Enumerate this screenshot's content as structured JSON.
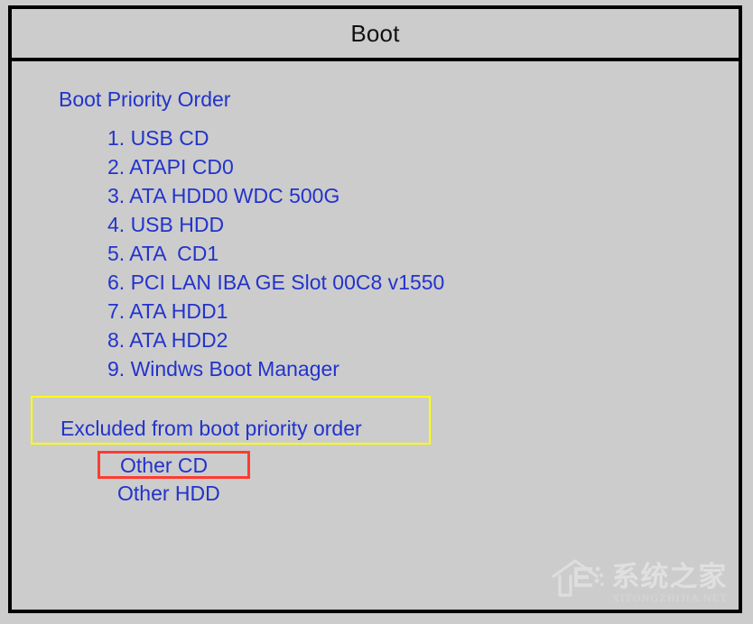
{
  "window": {
    "title": "Boot",
    "frame_border_color": "#000000",
    "background_color": "#cccccc"
  },
  "colors": {
    "text_blue": "#2233cc",
    "title_black": "#111111",
    "highlight_yellow": "#ffff00",
    "highlight_red": "#ff3b30",
    "watermark_white": "#e2e2e2"
  },
  "boot_priority": {
    "heading": "Boot Priority Order",
    "items": [
      {
        "index": "1.",
        "label": "USB CD",
        "text": "1. USB CD"
      },
      {
        "index": "2.",
        "label": "ATAPI CD0",
        "text": "2. ATAPI CD0"
      },
      {
        "index": "3.",
        "label": "ATA HDD0 WDC 500G",
        "text": "3. ATA HDD0 WDC 500G"
      },
      {
        "index": "4.",
        "label": "USB HDD",
        "text": "4. USB HDD"
      },
      {
        "index": "5.",
        "label": "ATA  CD1",
        "text": "5. ATA  CD1"
      },
      {
        "index": "6.",
        "label": "PCI LAN IBA GE Slot 00C8 v1550",
        "text": "6. PCI LAN IBA GE Slot 00C8 v1550"
      },
      {
        "index": "7.",
        "label": "ATA HDD1",
        "text": "7. ATA HDD1"
      },
      {
        "index": "8.",
        "label": "ATA HDD2",
        "text": "8. ATA HDD2"
      },
      {
        "index": "9.",
        "label": "Windws Boot Manager",
        "text": "9. Windws Boot Manager"
      }
    ]
  },
  "excluded": {
    "heading": "Excluded from boot priority order",
    "items": [
      {
        "label": "Other CD",
        "highlight": "red"
      },
      {
        "label": "Other HDD",
        "highlight": "none"
      }
    ]
  },
  "watermark": {
    "logo_icon": "house-logo-icon",
    "chinese_text": "系统之家",
    "latin_text": "XITONGZHIJIA.NET"
  }
}
